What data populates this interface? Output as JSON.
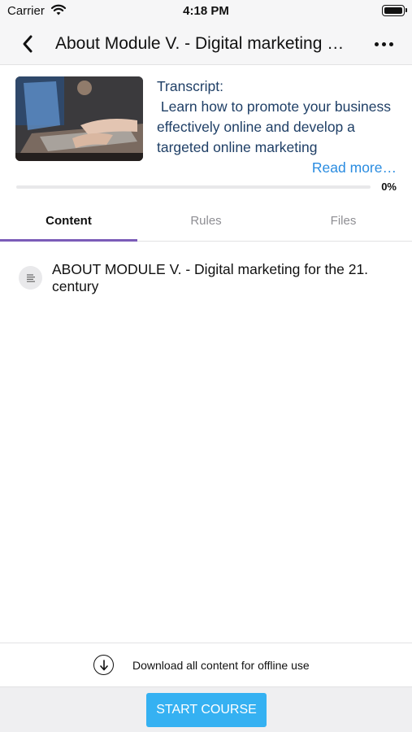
{
  "status_bar": {
    "carrier": "Carrier",
    "time": "4:18 PM"
  },
  "nav": {
    "title": "About Module V. - Digital marketing for the 21. century",
    "back_icon": "chevron-left-icon",
    "more_icon": "more-horizontal-icon"
  },
  "course": {
    "transcript_label": "Transcript:",
    "transcript_text": " Learn how to promote your business effectively online and develop a targeted online marketing",
    "read_more": "Read more…",
    "progress": 0,
    "progress_label": "0%"
  },
  "tabs": [
    {
      "label": "Content",
      "active": true
    },
    {
      "label": "Rules",
      "active": false
    },
    {
      "label": "Files",
      "active": false
    }
  ],
  "content_items": [
    {
      "title": "ABOUT MODULE V. - Digital marketing for the 21. century",
      "icon": "document-icon"
    }
  ],
  "download": {
    "label": "Download all content for offline use",
    "icon": "download-icon"
  },
  "footer": {
    "start_label": "START COURSE"
  },
  "colors": {
    "accent": "#7b5cb8",
    "link": "#2a8ce0",
    "button": "#35b1f2"
  }
}
